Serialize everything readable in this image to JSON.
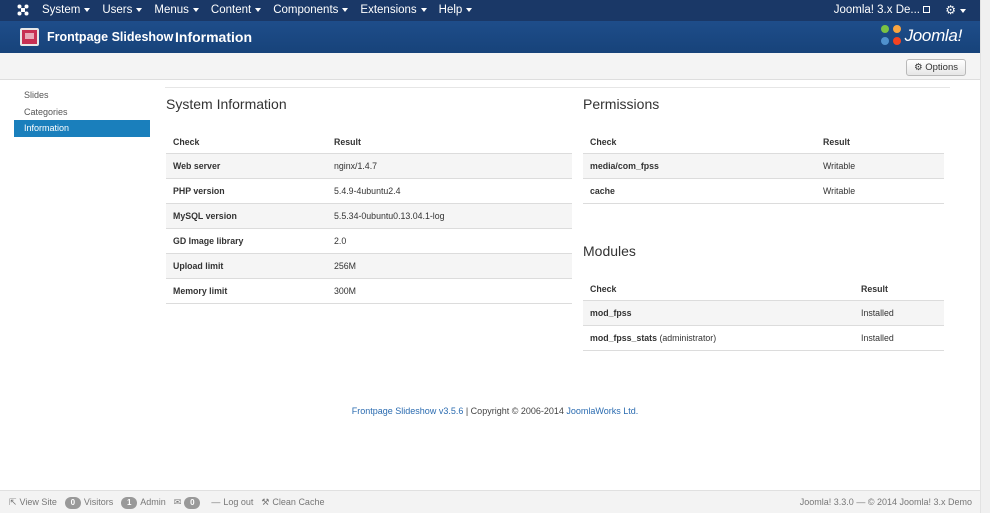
{
  "navbar": {
    "menus": [
      "System",
      "Users",
      "Menus",
      "Content",
      "Components",
      "Extensions",
      "Help"
    ],
    "site_name": "Joomla! 3.x De..."
  },
  "header": {
    "component": "Frontpage Slideshow",
    "title": "Information",
    "logo_text": "Joomla!"
  },
  "toolbar": {
    "options_label": "Options"
  },
  "sidebar": {
    "items": [
      {
        "label": "Slides"
      },
      {
        "label": "Categories"
      },
      {
        "label": "Information"
      }
    ]
  },
  "system_info": {
    "title": "System Information",
    "headers": [
      "Check",
      "Result"
    ],
    "rows": [
      {
        "check": "Web server",
        "result": "nginx/1.4.7"
      },
      {
        "check": "PHP version",
        "result": "5.4.9-4ubuntu2.4"
      },
      {
        "check": "MySQL version",
        "result": "5.5.34-0ubuntu0.13.04.1-log"
      },
      {
        "check": "GD Image library",
        "result": "2.0"
      },
      {
        "check": "Upload limit",
        "result": "256M"
      },
      {
        "check": "Memory limit",
        "result": "300M"
      }
    ]
  },
  "permissions": {
    "title": "Permissions",
    "headers": [
      "Check",
      "Result"
    ],
    "rows": [
      {
        "check": "media/com_fpss",
        "result": "Writable"
      },
      {
        "check": "cache",
        "result": "Writable"
      }
    ]
  },
  "modules": {
    "title": "Modules",
    "headers": [
      "Check",
      "Result"
    ],
    "rows": [
      {
        "check": "mod_fpss",
        "suffix": "",
        "result": "Installed"
      },
      {
        "check": "mod_fpss_stats",
        "suffix": "(administrator)",
        "result": "Installed"
      }
    ]
  },
  "credit": {
    "product_link": "Frontpage Slideshow v3.5.6",
    "middle": " | Copyright © 2006-2014 ",
    "company_link": "JoomlaWorks Ltd."
  },
  "statusbar": {
    "view_site": "View Site",
    "visitors_count": "0",
    "visitors_label": "Visitors",
    "admin_count": "1",
    "admin_label": "Admin",
    "messages_count": "0",
    "logout": "Log out",
    "clean_cache": "Clean Cache",
    "version": "Joomla! 3.3.0  —  © 2014 Joomla! 3.x Demo"
  },
  "colors": {
    "navbar": "#1a3867",
    "header": "#1e4d8a",
    "active_sidebar": "#1a7fbc",
    "link": "#2a6bb0"
  }
}
